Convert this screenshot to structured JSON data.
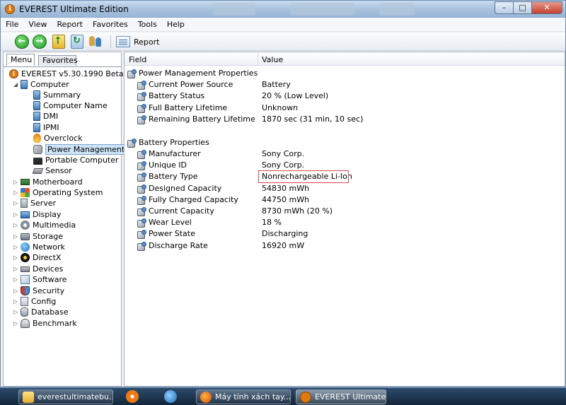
{
  "window": {
    "title": "EVEREST Ultimate Edition"
  },
  "menubar": {
    "items": [
      "File",
      "View",
      "Report",
      "Favorites",
      "Tools",
      "Help"
    ]
  },
  "toolbar": {
    "report_label": "Report"
  },
  "tabs": {
    "menu": "Menu",
    "favorites": "Favorites"
  },
  "tree": {
    "root": "EVEREST v5.30.1990 Beta",
    "computer": "Computer",
    "computer_children": [
      "Summary",
      "Computer Name",
      "DMI",
      "IPMI",
      "Overclock",
      "Power Management",
      "Portable Computer",
      "Sensor"
    ],
    "categories": [
      "Motherboard",
      "Operating System",
      "Server",
      "Display",
      "Multimedia",
      "Storage",
      "Network",
      "DirectX",
      "Devices",
      "Software",
      "Security",
      "Config",
      "Database",
      "Benchmark"
    ]
  },
  "columns": {
    "field": "Field",
    "value": "Value"
  },
  "groups": [
    {
      "title": "Power Management Properties",
      "rows": [
        {
          "field": "Current Power Source",
          "value": "Battery"
        },
        {
          "field": "Battery Status",
          "value": "20 % (Low Level)"
        },
        {
          "field": "Full Battery Lifetime",
          "value": "Unknown"
        },
        {
          "field": "Remaining Battery Lifetime",
          "value": "1870 sec (31 min, 10 sec)"
        }
      ]
    },
    {
      "title": "Battery Properties",
      "rows": [
        {
          "field": "Manufacturer",
          "value": "Sony Corp."
        },
        {
          "field": "Unique ID",
          "value": "Sony Corp."
        },
        {
          "field": "Battery Type",
          "value": "Nonrechargeable Li-Ion"
        },
        {
          "field": "Designed Capacity",
          "value": "54830 mWh"
        },
        {
          "field": "Fully Charged Capacity",
          "value": "44750 mWh"
        },
        {
          "field": "Current Capacity",
          "value": "8730 mWh  (20 %)"
        },
        {
          "field": "Wear Level",
          "value": "18 %"
        },
        {
          "field": "Power State",
          "value": "Discharging"
        },
        {
          "field": "Discharge Rate",
          "value": "16920 mW"
        }
      ]
    }
  ],
  "taskbar": {
    "buttons": [
      "everestultimatebu...",
      "Máy tính xách tay...",
      "EVEREST Ultimate..."
    ]
  }
}
